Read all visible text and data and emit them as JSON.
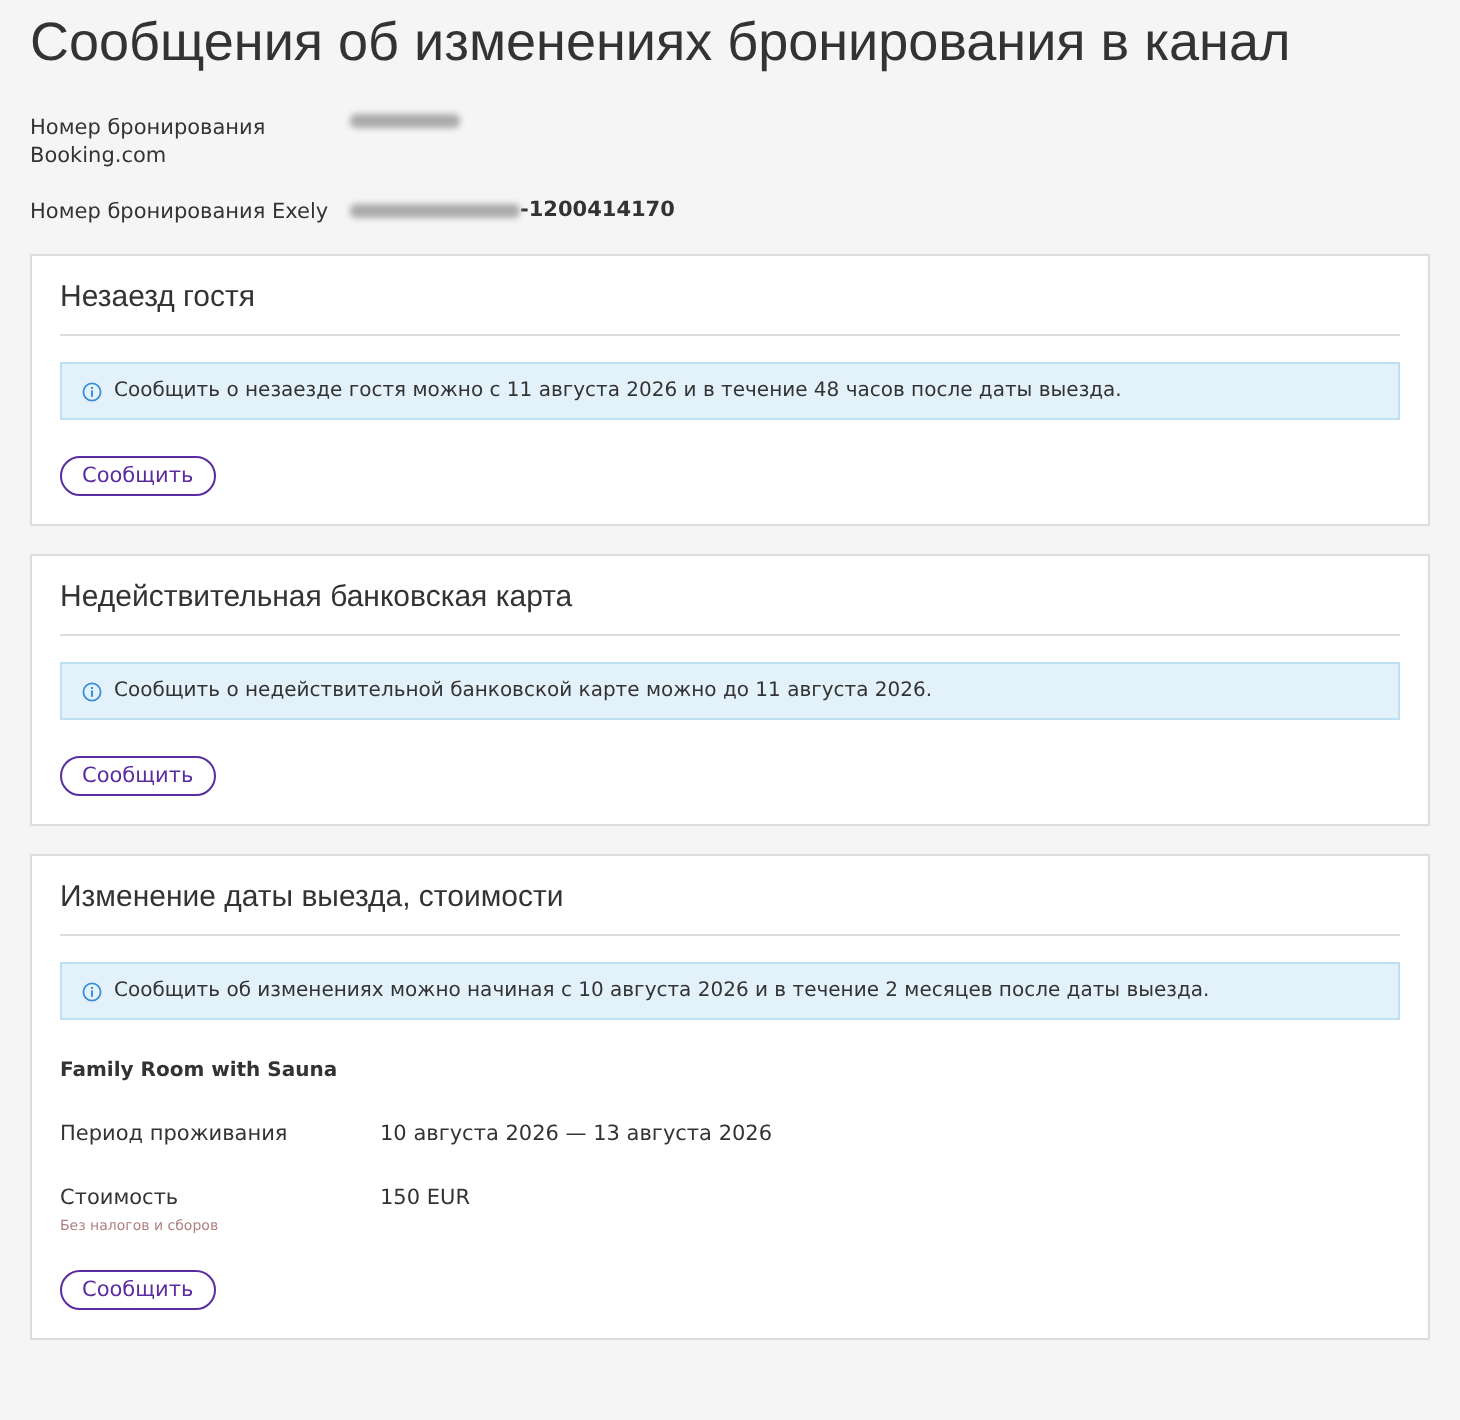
{
  "title": "Сообщения об изменениях бронирования в канал",
  "booking_info": [
    {
      "label": "Номер бронирования Booking.com",
      "redacted": true
    },
    {
      "label": "Номер бронирования Exely",
      "redacted": true,
      "value_suffix": "-1200414170"
    }
  ],
  "sections": [
    {
      "title": "Незаезд гостя",
      "notice": "Сообщить о незаезде гостя можно с 11 августа 2026 и в течение 48 часов после даты выезда.",
      "button": "Сообщить"
    },
    {
      "title": "Недействительная банковская карта",
      "notice": "Сообщить о недействительной банковской карте можно до 11 августа 2026.",
      "button": "Сообщить"
    },
    {
      "title": "Изменение даты выезда, стоимости",
      "notice": "Сообщить об изменениях можно начиная с 10 августа 2026 и в течение 2 месяцев после даты выезда.",
      "room": "Family Room with Sauna",
      "details": [
        {
          "label": "Период проживания",
          "value": "10 августа 2026 — 13 августа 2026"
        },
        {
          "label": "Стоимость",
          "hint": "Без налогов и сборов",
          "value": "150 EUR"
        }
      ],
      "button": "Сообщить"
    }
  ]
}
